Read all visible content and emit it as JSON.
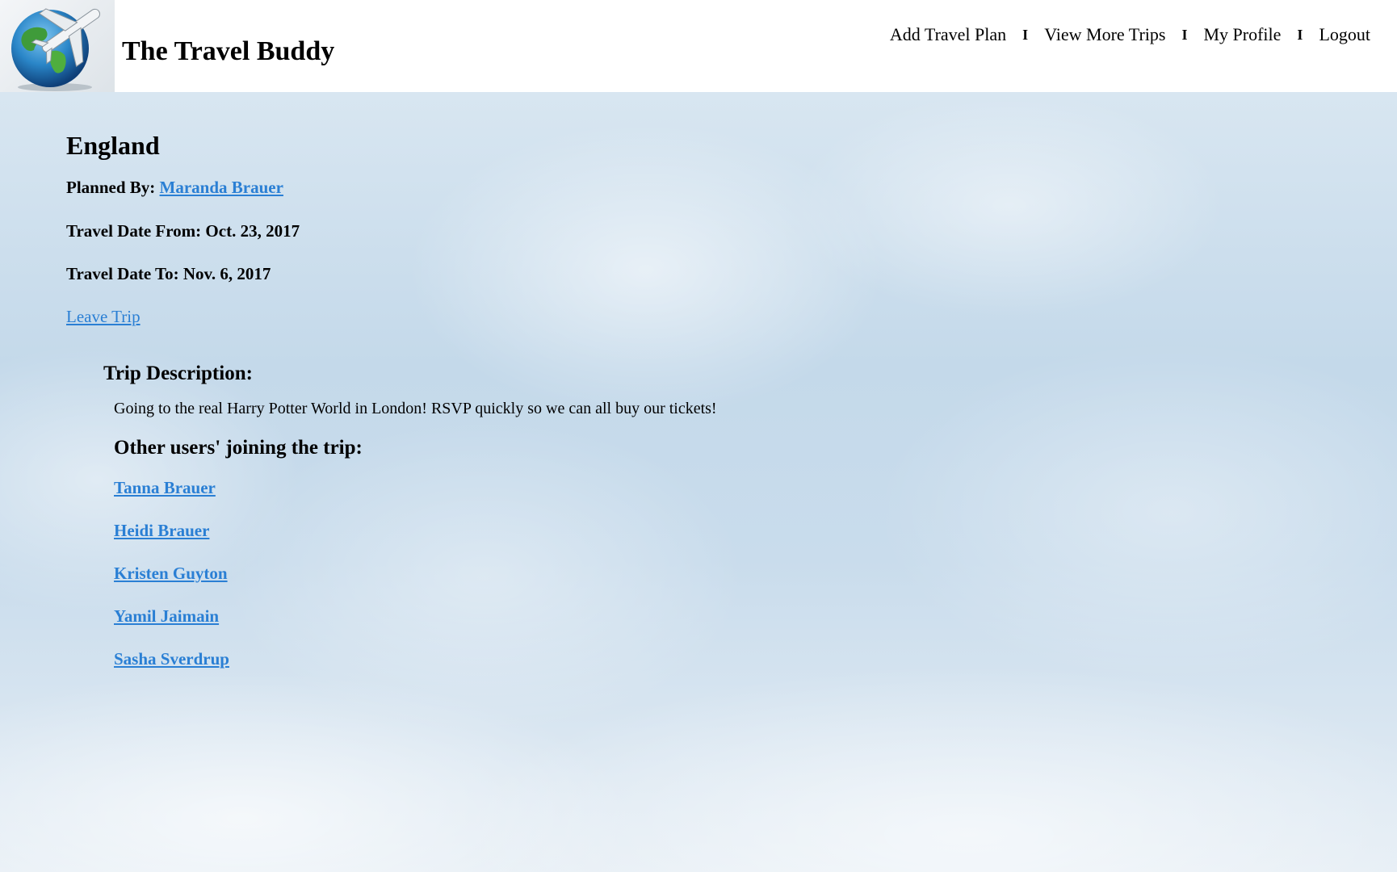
{
  "header": {
    "site_title": "The Travel Buddy",
    "logo_icon": "globe-airplane-icon",
    "nav": [
      {
        "label": "Add Travel Plan"
      },
      {
        "label": "View More Trips"
      },
      {
        "label": "My Profile"
      },
      {
        "label": "Logout"
      }
    ],
    "separator": "I"
  },
  "trip": {
    "destination": "England",
    "planned_by_label": "Planned By:",
    "planner_name": "Maranda Brauer",
    "date_from_label": "Travel Date From:",
    "date_from": "Oct. 23, 2017",
    "date_to_label": "Travel Date To:",
    "date_to": "Nov. 6, 2017",
    "leave_label": "Leave Trip",
    "description_heading": "Trip Description:",
    "description": "Going to the real Harry Potter World in London! RSVP quickly so we can all buy our tickets!",
    "participants_heading": "Other users' joining the trip:",
    "participants": [
      {
        "name": "Tanna Brauer"
      },
      {
        "name": "Heidi Brauer"
      },
      {
        "name": "Kristen Guyton"
      },
      {
        "name": "Yamil Jaimain"
      },
      {
        "name": "Sasha Sverdrup"
      }
    ]
  },
  "colors": {
    "link": "#2a7fd4",
    "header_bg": "#ffffff",
    "sky": "#c4d9ea"
  }
}
